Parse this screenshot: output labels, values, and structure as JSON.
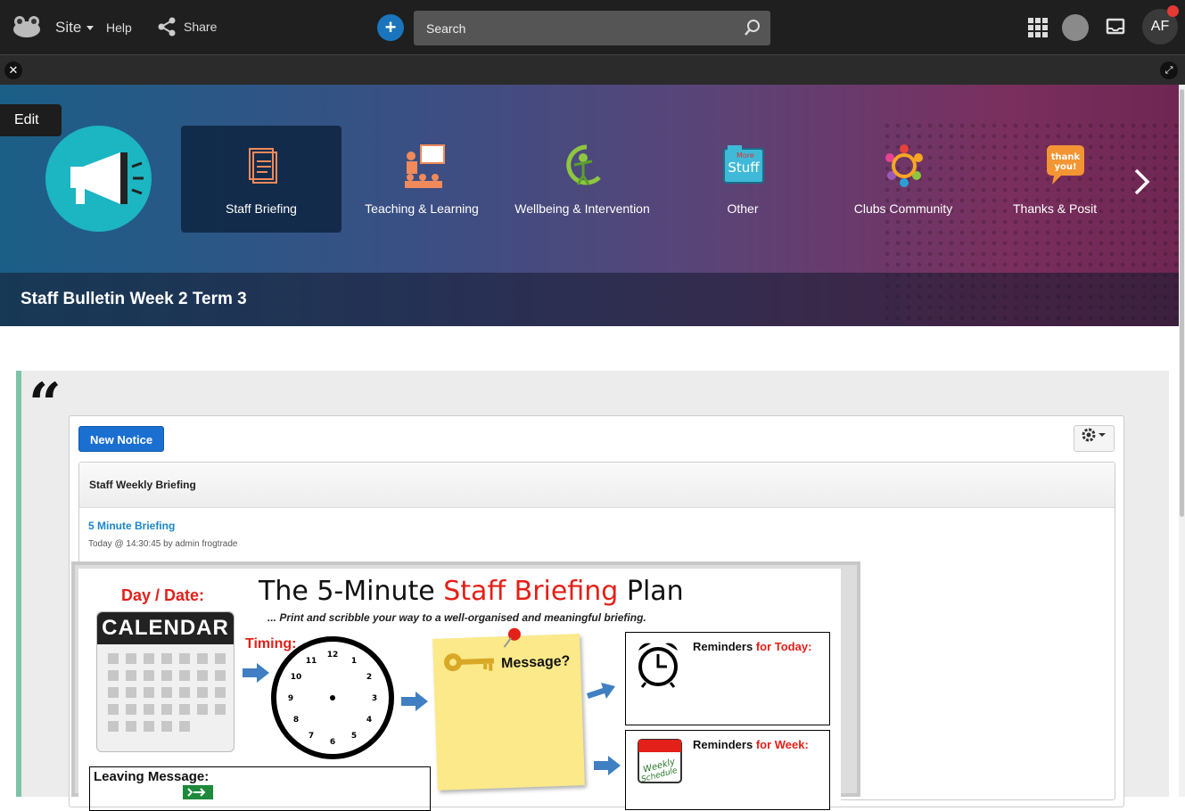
{
  "topbar": {
    "site_label": "Site",
    "help_label": "Help",
    "share_label": "Share",
    "search_placeholder": "Search",
    "avatar_initials": "AF"
  },
  "banner": {
    "edit_label": "Edit",
    "nav_items": [
      {
        "label": "Staff Briefing",
        "icon": "briefing-document-icon",
        "active": true
      },
      {
        "label": "Teaching & Learning",
        "icon": "teacher-presentation-icon",
        "active": false
      },
      {
        "label": "Wellbeing & Intervention",
        "icon": "wellbeing-figure-icon",
        "active": false
      },
      {
        "label": "Other",
        "icon": "more-stuff-folder-icon",
        "active": false
      },
      {
        "label": "Clubs Community",
        "icon": "community-circle-icon",
        "active": false
      },
      {
        "label": "Thanks & Positi",
        "icon": "thank-you-bubble-icon",
        "active": false
      }
    ],
    "page_title": "Staff Bulletin Week 2 Term 3"
  },
  "content": {
    "new_notice_label": "New Notice",
    "box_title": "Staff Weekly Briefing",
    "notice": {
      "title": "5 Minute Briefing",
      "meta": "Today @ 14:30:45 by admin frogtrade"
    }
  },
  "briefing_image": {
    "day_label": "Day / Date:",
    "title_part1": "The 5-Minute ",
    "title_red": "Staff Briefing",
    "title_part2": " Plan",
    "subtitle": "... Print and scribble your way to a well-organised and meaningful briefing.",
    "calendar_label": "CALENDAR",
    "timing_label": "Timing:",
    "message_label": "Message?",
    "reminders_today_a": "Reminders ",
    "reminders_today_b": "for Today:",
    "reminders_week_a": "Reminders ",
    "reminders_week_b": "for Week:",
    "leaving_label": "Leaving Message:",
    "clock_numbers": [
      "12",
      "1",
      "2",
      "3",
      "4",
      "5",
      "6",
      "7",
      "8",
      "9",
      "10",
      "11"
    ]
  },
  "colors": {
    "accent_blue": "#1a6fd1",
    "brand_red": "#e32019",
    "quote_bar": "#7dc3a7"
  }
}
